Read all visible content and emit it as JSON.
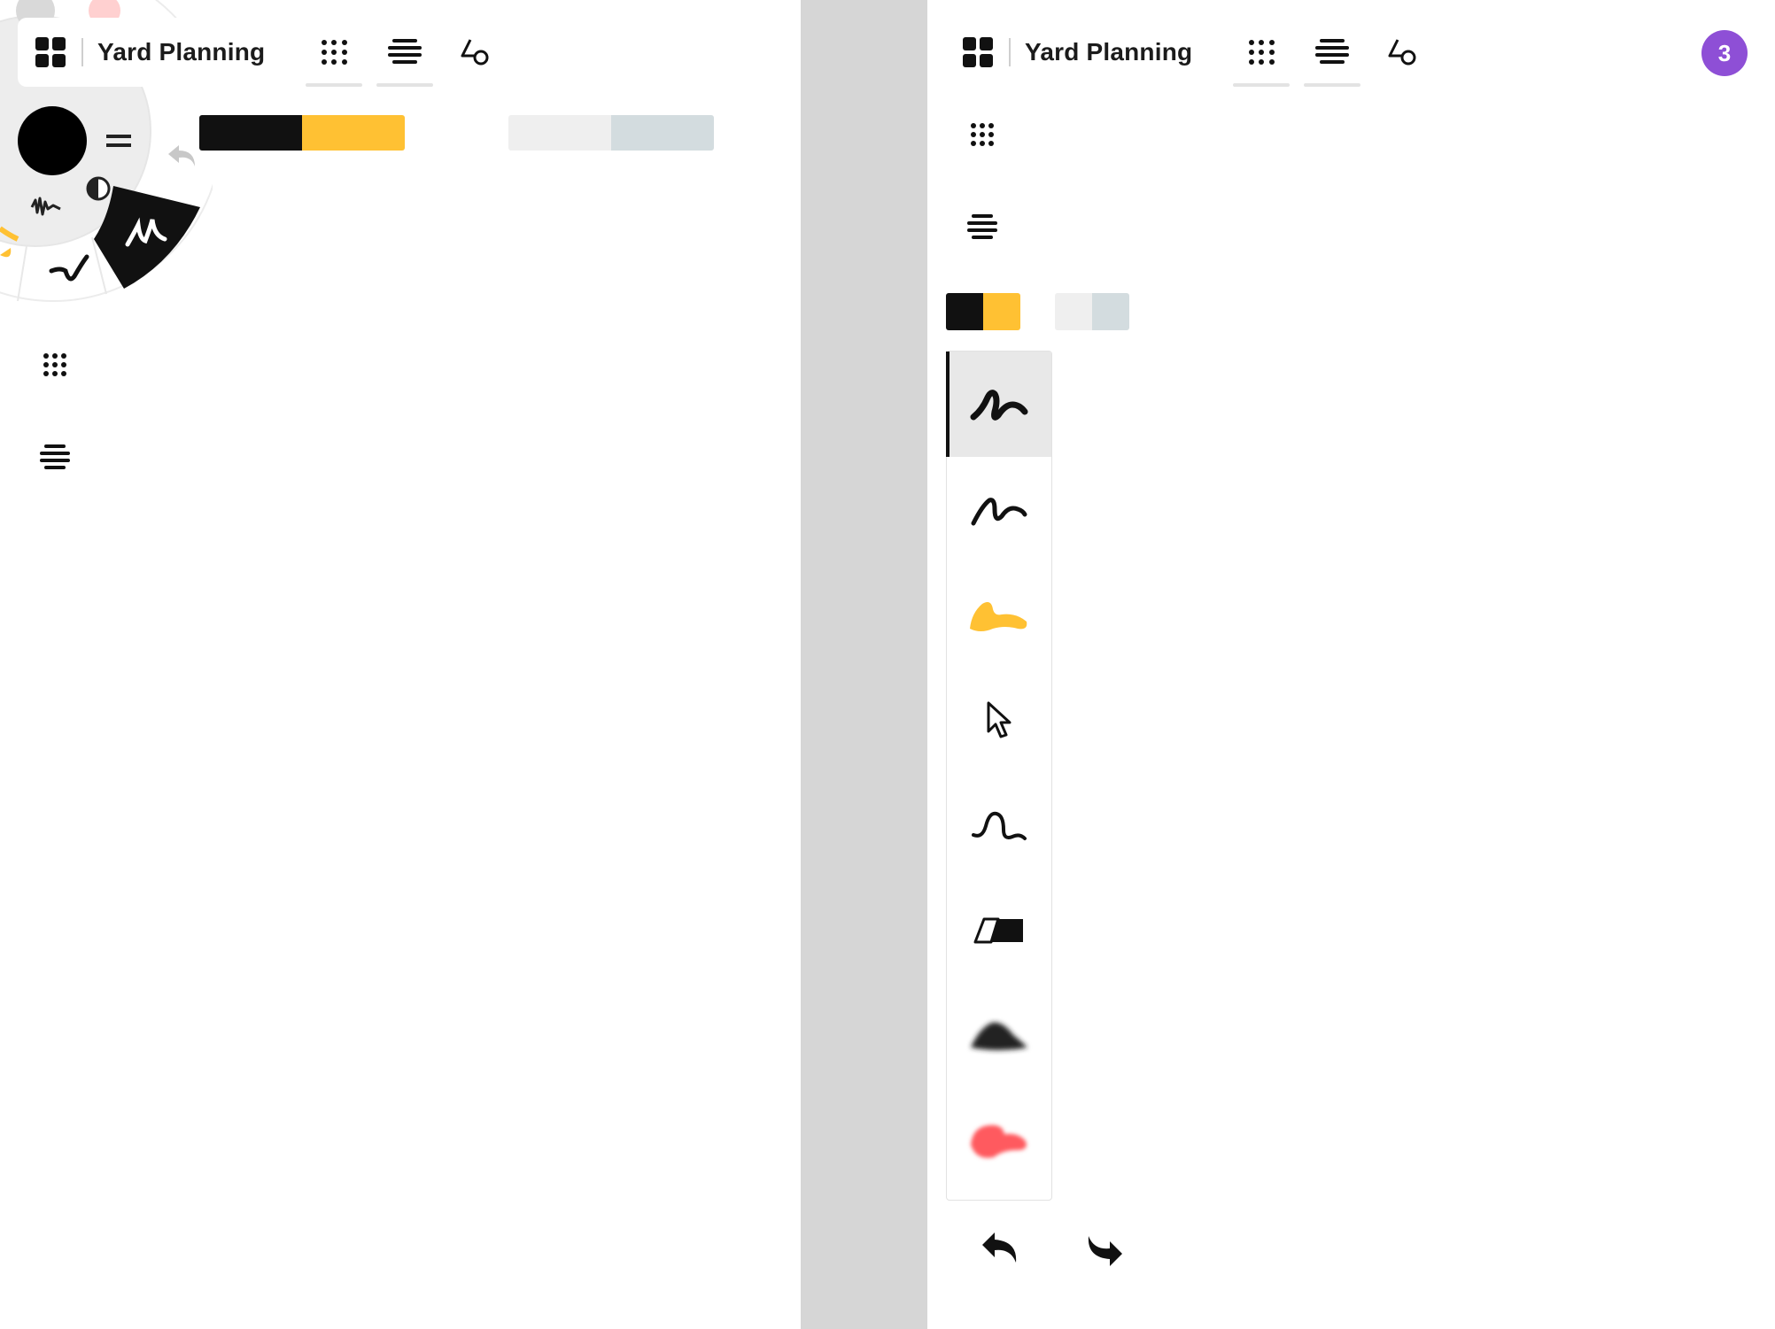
{
  "app": {
    "title": "Yard Planning",
    "colors": {
      "accent": "#8e4fd6",
      "black": "#111111",
      "yellow": "#ffc133",
      "light_gray": "#efefef",
      "blue_gray": "#d3dcdf"
    }
  },
  "left": {
    "header": {
      "title": "Yard Planning",
      "icons": [
        "grid-icon",
        "dot-grid-icon",
        "layers-icon",
        "shapes-icon"
      ]
    },
    "radial_menu": {
      "icons": [
        "color-swatch-icon",
        "stroke-width-icon",
        "undo-icon",
        "contrast-icon",
        "brush-texture-icon",
        "pen-icon",
        "brush-icon"
      ]
    },
    "palette": [
      {
        "colors": [
          "#111111",
          "#ffc133"
        ]
      },
      {
        "colors": [
          "#efefef",
          "#d3dcdf"
        ]
      }
    ],
    "sidebar": {
      "icons": [
        "dot-grid-icon",
        "layers-icon"
      ]
    }
  },
  "right": {
    "header": {
      "title": "Yard Planning",
      "icons": [
        "grid-icon",
        "dot-grid-icon",
        "layers-icon",
        "shapes-icon"
      ]
    },
    "badge": {
      "count": "3"
    },
    "sidebar": {
      "icons": [
        "dot-grid-icon",
        "layers-icon"
      ]
    },
    "palette": [
      {
        "colors": [
          "#111111",
          "#ffc133"
        ]
      },
      {
        "colors": [
          "#efefef",
          "#d3dcdf"
        ]
      }
    ],
    "brushes": [
      {
        "name": "pen-icon",
        "selected": true
      },
      {
        "name": "marker-icon",
        "selected": false
      },
      {
        "name": "highlighter-icon",
        "selected": false
      },
      {
        "name": "select-cursor-icon",
        "selected": false
      },
      {
        "name": "curve-icon",
        "selected": false
      },
      {
        "name": "eraser-icon",
        "selected": false
      },
      {
        "name": "smudge-icon",
        "selected": false
      },
      {
        "name": "airbrush-icon",
        "selected": false
      }
    ],
    "actions": [
      "undo-icon",
      "redo-icon"
    ]
  }
}
